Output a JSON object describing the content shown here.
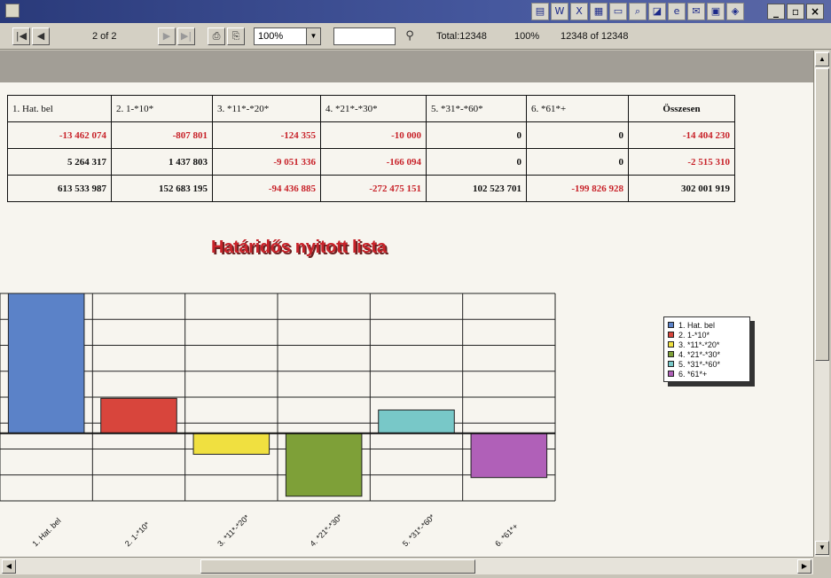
{
  "toolbar": {
    "page_indicator": "2 of 2",
    "zoom": "100%",
    "search_value": "",
    "total_label": "Total:12348",
    "percent": "100%",
    "count_of": "12348 of 12348"
  },
  "title_tray": {
    "icons": [
      "monitor-icon",
      "word-icon",
      "excel-icon",
      "calculator-icon",
      "window-icon",
      "search-icon",
      "chart-icon",
      "browser-icon",
      "mail-icon",
      "app-icon",
      "app2-icon"
    ]
  },
  "table": {
    "headers": [
      "1. Hat. bel",
      "2. 1-*10*",
      "3. *11*-*20*",
      "4. *21*-*30*",
      "5. *31*-*60*",
      "6. *61*+",
      "Összesen"
    ],
    "rows": [
      [
        "-13 462 074",
        "-807 801",
        "-124 355",
        "-10 000",
        "0",
        "0",
        "-14 404 230"
      ],
      [
        "5 264 317",
        "1 437 803",
        "-9 051 336",
        "-166 094",
        "0",
        "0",
        "-2 515 310"
      ],
      [
        "613 533 987",
        "152 683 195",
        "-94 436 885",
        "-272 475 151",
        "102 523 701",
        "-199 826 928",
        "302 001 919"
      ]
    ]
  },
  "chart_data": {
    "type": "bar",
    "title": "Határidős nyitott lista",
    "categories": [
      "1. Hat. bel",
      "2. 1-*10*",
      "3. *11*-*20*",
      "4. *21*-*30*",
      "5. *31*-*60*",
      "6. *61*+"
    ],
    "values": [
      6.0,
      1.5,
      -0.9,
      -2.7,
      1.0,
      -1.9
    ],
    "colors": [
      "#5b82c8",
      "#d8453c",
      "#f0e040",
      "#7ea038",
      "#78c8c8",
      "#b060b8"
    ],
    "ylim": [
      -2.9,
      6.0
    ],
    "legend_position": "right",
    "grid": true
  }
}
